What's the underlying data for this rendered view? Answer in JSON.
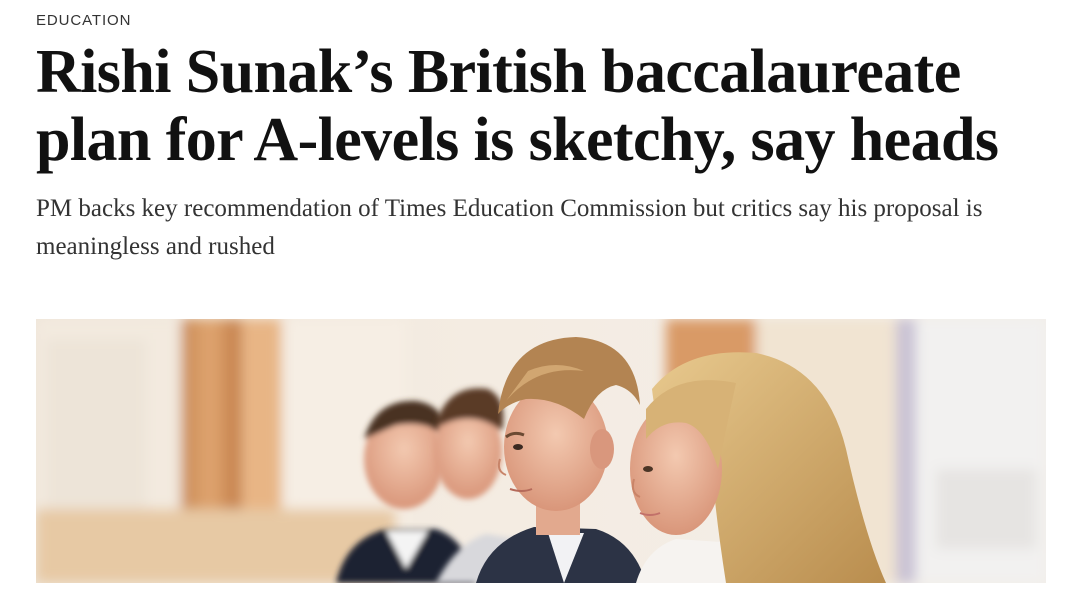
{
  "article": {
    "section": "EDUCATION",
    "headline": "Rishi Sunak’s British baccalaureate plan for A-levels is sketchy, say heads",
    "standfirst": "PM backs key recommendation of Times Education Commission but critics say his proposal is meaningless and rushed"
  },
  "hero_image": {
    "description_icon": "photo-of-students"
  },
  "colors": {
    "headline": "#111111",
    "standfirst": "#333333",
    "section": "#333333",
    "background": "#ffffff"
  }
}
